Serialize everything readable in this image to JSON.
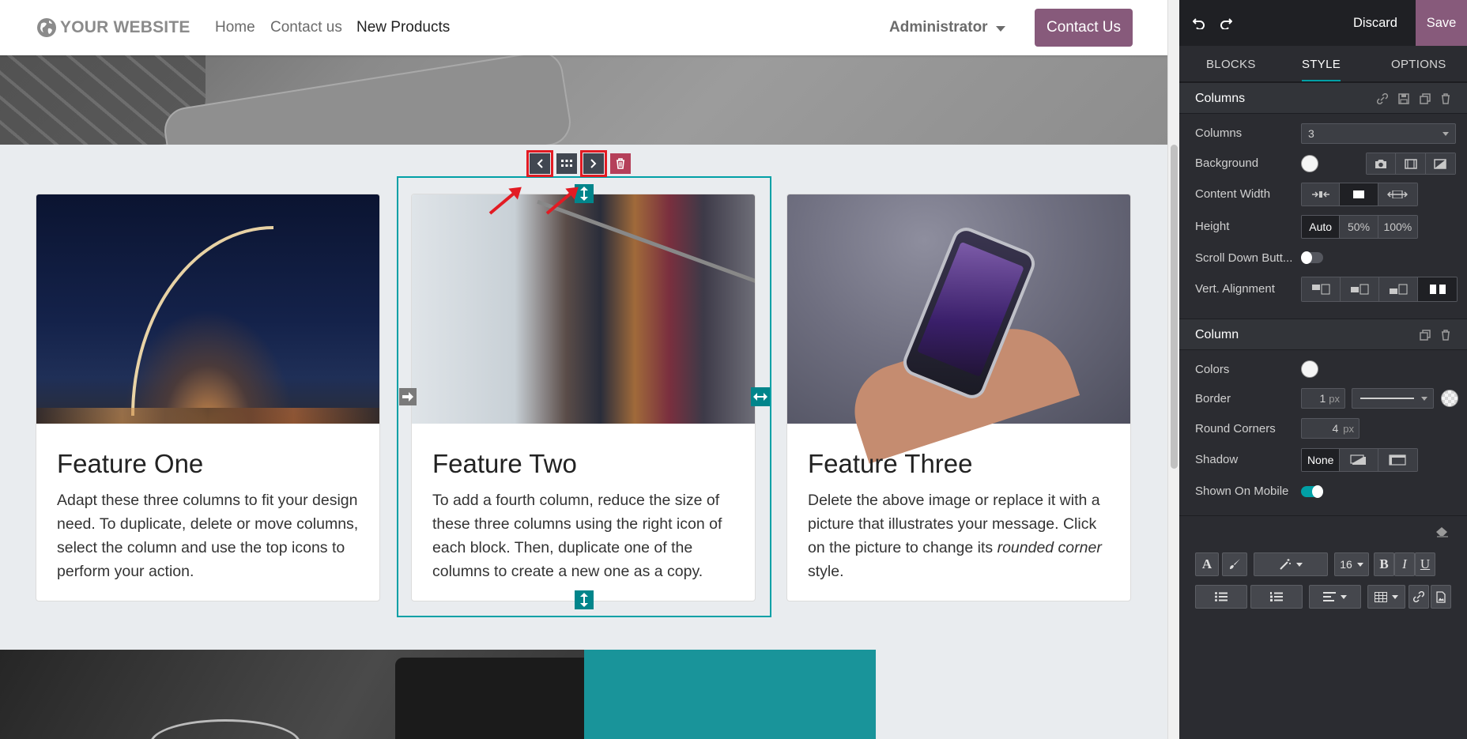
{
  "site": {
    "logo_text": "YOUR WEBSITE",
    "nav": [
      {
        "label": "Home",
        "active": false
      },
      {
        "label": "Contact us",
        "active": false
      },
      {
        "label": "New Products",
        "active": true
      }
    ],
    "user_menu": "Administrator",
    "cta_button": "Contact Us",
    "features": [
      {
        "title": "Feature One",
        "text": "Adapt these three columns to fit your design need. To duplicate, delete or move columns, select the column and use the top icons to perform your action."
      },
      {
        "title": "Feature Two",
        "text": "To add a fourth column, reduce the size of these three columns using the right icon of each block. Then, duplicate one of the columns to create a new one as a copy."
      },
      {
        "title": "Feature Three",
        "text_before": "Delete the above image or replace it with a picture that illustrates your message. Click on the picture to change its ",
        "text_em": "rounded corner",
        "text_after": " style."
      }
    ],
    "move_toolbar": [
      "move-left",
      "drag-grid",
      "move-right",
      "delete"
    ],
    "colors": {
      "accent": "#01a0a6",
      "brand": "#875a7b",
      "annotation": "#e21b23"
    }
  },
  "editor": {
    "discard_label": "Discard",
    "save_label": "Save",
    "tabs": [
      {
        "label": "BLOCKS",
        "active": false
      },
      {
        "label": "STYLE",
        "active": true
      },
      {
        "label": "OPTIONS",
        "active": false
      }
    ],
    "columns_section": {
      "title": "Columns",
      "columns_label": "Columns",
      "columns_value": "3",
      "background_label": "Background",
      "content_width_label": "Content Width",
      "height_label": "Height",
      "height_options": [
        "Auto",
        "50%",
        "100%"
      ],
      "height_selected": "Auto",
      "scroll_down_label": "Scroll Down Butt...",
      "scroll_down_on": false,
      "vert_alignment_label": "Vert. Alignment"
    },
    "column_section": {
      "title": "Column",
      "colors_label": "Colors",
      "border_label": "Border",
      "border_value": "1",
      "border_unit": "px",
      "round_corners_label": "Round Corners",
      "round_corners_value": "4",
      "round_corners_unit": "px",
      "shadow_label": "Shadow",
      "shadow_options": [
        "None"
      ],
      "shown_on_mobile_label": "Shown On Mobile",
      "shown_on_mobile_on": true
    },
    "text_toolbar": {
      "font_size": "16",
      "bold": "B",
      "italic": "I",
      "underline": "U",
      "font_color": "A"
    }
  }
}
